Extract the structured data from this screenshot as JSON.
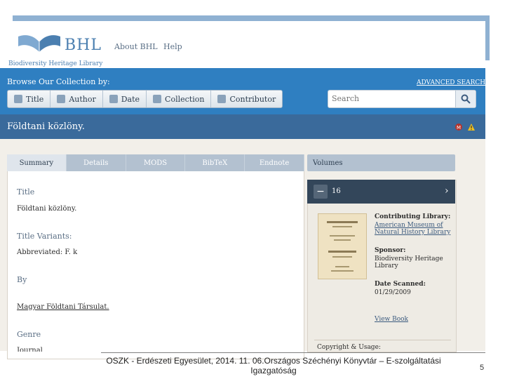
{
  "header": {
    "logo_text": "BHL",
    "logo_subtitle": "Biodiversity Heritage Library",
    "nav": [
      "About BHL",
      "Help"
    ]
  },
  "browse": {
    "label": "Browse Our Collection by:",
    "buttons": [
      "Title",
      "Author",
      "Date",
      "Collection",
      "Contributor"
    ],
    "advanced_search": "ADVANCED SEARCH",
    "search_placeholder": "Search"
  },
  "page_title": "Földtani közlöny.",
  "tabs": [
    "Summary",
    "Details",
    "MODS",
    "BibTeX",
    "Endnote"
  ],
  "summary": {
    "title_label": "Title",
    "title_value": "Földtani közlöny.",
    "variants_label": "Title Variants:",
    "variants_value": "Abbreviated: F. k",
    "by_label": "By",
    "by_value": "Magyar Földtani Társulat.",
    "genre_label": "Genre",
    "genre_value": "Journal"
  },
  "volumes": {
    "header": "Volumes",
    "current": "16",
    "contributing_label": "Contributing Library:",
    "contributing_value": "American Museum of Natural History Library",
    "sponsor_label": "Sponsor:",
    "sponsor_value": "Biodiversity Heritage Library",
    "scanned_label": "Date Scanned:",
    "scanned_value": "01/29/2009",
    "view_book": "View Book",
    "copyright": "Copyright & Usage:"
  },
  "footer": {
    "text": "OSZK - Erdészeti Egyesület, 2014. 11. 06.Országos Széchényi Könyvtár – E-szolgáltatási Igazgatóság",
    "page_number": "5"
  },
  "colors": {
    "band": "#2f7fc1",
    "title_band": "#3a6a9b",
    "tabs": "#b3c1d0"
  }
}
